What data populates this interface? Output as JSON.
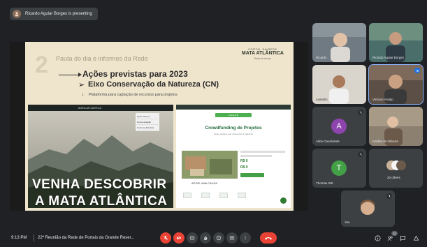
{
  "presenting": {
    "text": "Ricardo Aguiar Borges is presenting"
  },
  "slide": {
    "number": "2",
    "pauta": "Pauta do dia e informes da Rede",
    "acoes": "Ações previstas para 2023",
    "eixo": "Eixo Conservação da Natureza (CN)",
    "item": "Plataforma para captação de recursos para projetos",
    "brand_small": "PORTAL DA REDE",
    "brand_main": "MATA ATLÂNTICA",
    "brand_sub": "Rede de trocas",
    "hero_line1": "VENHA DESCOBRIR",
    "hero_line2": "A MATA ATLÂNTICA",
    "site_logo": "MATA ATLÂNTICA",
    "dropdown": [
      "Quem Somos",
      "Nossa atuação",
      "Como se Envolver"
    ],
    "cf_pill": "VALE ATÉ",
    "cf_title": "Crowdfunding de Projetos",
    "cf_sub": "Apoie projetos que conservam a natureza",
    "cf_card": "APOIE UMA CAUSA",
    "cf_amount1": "R$ 0",
    "cf_amount2": "R$ 0"
  },
  "participants": [
    {
      "name": "Ricardo",
      "type": "video"
    },
    {
      "name": "Ricardo Aguiar Borges",
      "type": "video"
    },
    {
      "name": "Leandro",
      "type": "video"
    },
    {
      "name": "Vinícius Araújo",
      "type": "video"
    },
    {
      "name": "Aline Cavalcante",
      "type": "avatar",
      "letter": "A",
      "color": "#8e44ad"
    },
    {
      "name": "Natália de Oliveira",
      "type": "video"
    },
    {
      "name": "Thomas ISK",
      "type": "avatar",
      "letter": "T",
      "color": "#43a047"
    },
    {
      "name": "20 others",
      "type": "group"
    },
    {
      "name": "You",
      "type": "video"
    }
  ],
  "bottom": {
    "time": "9:13 PM",
    "meeting_title": "22ª Reunião da Rede de Portais da Grande Reser...",
    "people_count": "32"
  },
  "colors": {
    "background": "#202124",
    "tile": "#3c4043",
    "red": "#ea4335",
    "active": "#8ab4f8"
  }
}
